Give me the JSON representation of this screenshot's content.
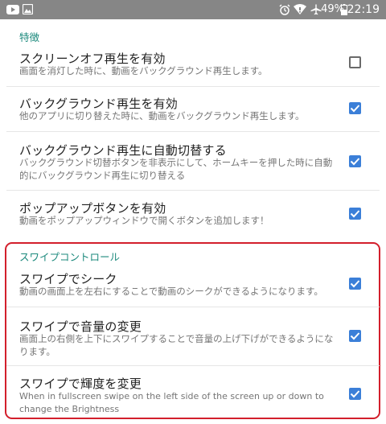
{
  "status_bar": {
    "battery_percent": "49%",
    "time": "22:19",
    "icons": [
      "youtube-icon",
      "image-icon",
      "alarm-icon",
      "wifi-icon",
      "airplane-icon",
      "battery-icon"
    ]
  },
  "sections": {
    "features": {
      "header": "特徴",
      "items": [
        {
          "title": "スクリーンオフ再生を有効",
          "summary": "画面を消灯した時に、動画をバックグラウンド再生します。",
          "checked": false
        },
        {
          "title": "バックグラウンド再生を有効",
          "summary": "他のアプリに切り替えた時に、動画をバックグラウンド再生します。",
          "checked": true
        },
        {
          "title": "バックグラウンド再生に自動切替する",
          "summary": "バックグラウンド切替ボタンを非表示にして、ホームキーを押した時に自動的にバックグラウンド再生に切り替える",
          "checked": true
        },
        {
          "title": "ポップアップボタンを有効",
          "summary": "動画をポップアップウィンドウで開くボタンを追加します！",
          "checked": true
        }
      ]
    },
    "swipe": {
      "header": "スワイプコントロール",
      "items": [
        {
          "title": "スワイプでシーク",
          "summary": "動画の画面上を左右にすることで動画のシークができるようになります。",
          "checked": true
        },
        {
          "title": "スワイプで音量の変更",
          "summary": "画面上の右側を上下にスワイプすることで音量の上げ下げができるようになります。",
          "checked": true
        },
        {
          "title": "スワイプで輝度を変更",
          "summary": "When in fullscreen swipe on the left side of the screen up or down to change the Brightness",
          "checked": true
        }
      ]
    }
  },
  "colors": {
    "accent": "#1d8a7d",
    "checkbox": "#3b7fd8",
    "highlight": "#d31f2c",
    "status_bar": "#868686"
  }
}
